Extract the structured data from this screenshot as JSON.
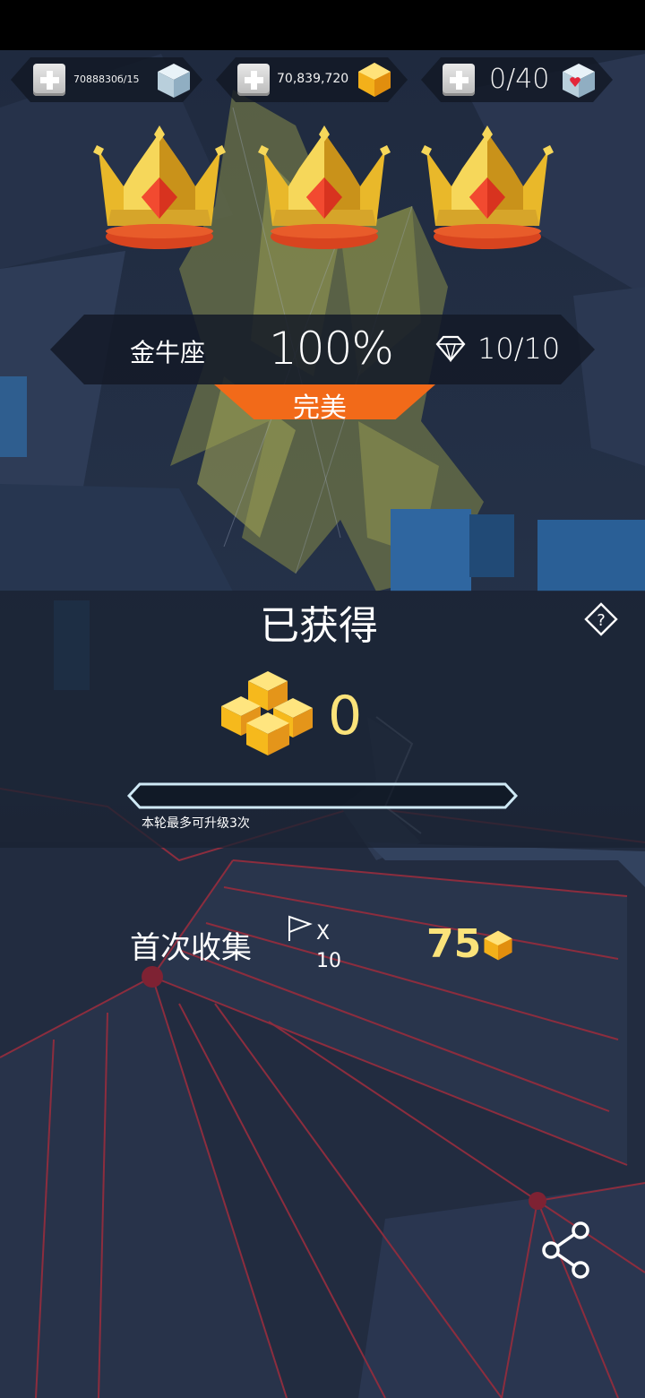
{
  "colors": {
    "gold_text": "#fbe37a",
    "rank_orange": "#f26a19",
    "panel_dark": "#141a28",
    "progress_outline": "#cfe9f5"
  },
  "currencies": [
    {
      "name": "blue-cube-currency",
      "value": "7088830б/15",
      "icon": "blue-cube-icon"
    },
    {
      "name": "gold-gem-currency",
      "value": "70,839,720",
      "icon": "gold-gem-icon"
    },
    {
      "name": "heart-cube-currency",
      "value": "0/40",
      "icon": "heart-cube-icon"
    }
  ],
  "crowns": {
    "count": 3,
    "icon": "crown-icon"
  },
  "result": {
    "level_name": "金牛座",
    "percent": "100%",
    "diamonds": "10/10",
    "rank_label": "完美"
  },
  "reward": {
    "title": "已获得",
    "amount": "0",
    "upgrade_progress": 0,
    "upgrade_note": "本轮最多可升级3次"
  },
  "first_collect": {
    "label": "首次收集",
    "flag_mult": "X",
    "flag_count": "10",
    "gems": "75"
  },
  "icons": {
    "help": "help-icon",
    "share": "share-icon",
    "flag": "flag-icon",
    "diamond": "diamond-outline-icon",
    "gold_stack": "gold-cube-stack-icon"
  }
}
